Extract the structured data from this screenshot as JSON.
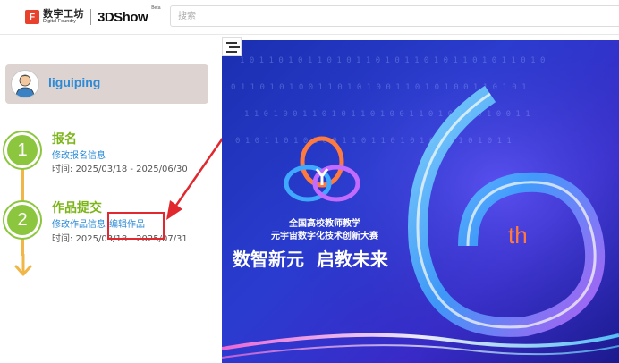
{
  "header": {
    "logo_cn": "数字工坊",
    "logo_en": "Digital Foundry",
    "logo_product": "3DShow",
    "logo_beta": "Beta",
    "search_placeholder": "搜索"
  },
  "user": {
    "name": "liguiping"
  },
  "steps": [
    {
      "number": "1",
      "title": "报名",
      "links": [
        "修改报名信息"
      ],
      "time": "时间: 2025/03/18 - 2025/06/30"
    },
    {
      "number": "2",
      "title": "作品提交",
      "links": [
        "修改作品信息",
        "编辑作品"
      ],
      "time": "时间: 2025/03/18 - 2025/07/31"
    }
  ],
  "banner": {
    "contest_line1": "全国高校教师教学",
    "contest_line2": "元宇宙数字化技术创新大赛",
    "slogan": "数智新元  启教未来",
    "edition": "th"
  },
  "colors": {
    "accent_green": "#8cc63f",
    "link_blue": "#2d8bd6",
    "timeline": "#f0b648",
    "highlight": "#e0282e"
  }
}
